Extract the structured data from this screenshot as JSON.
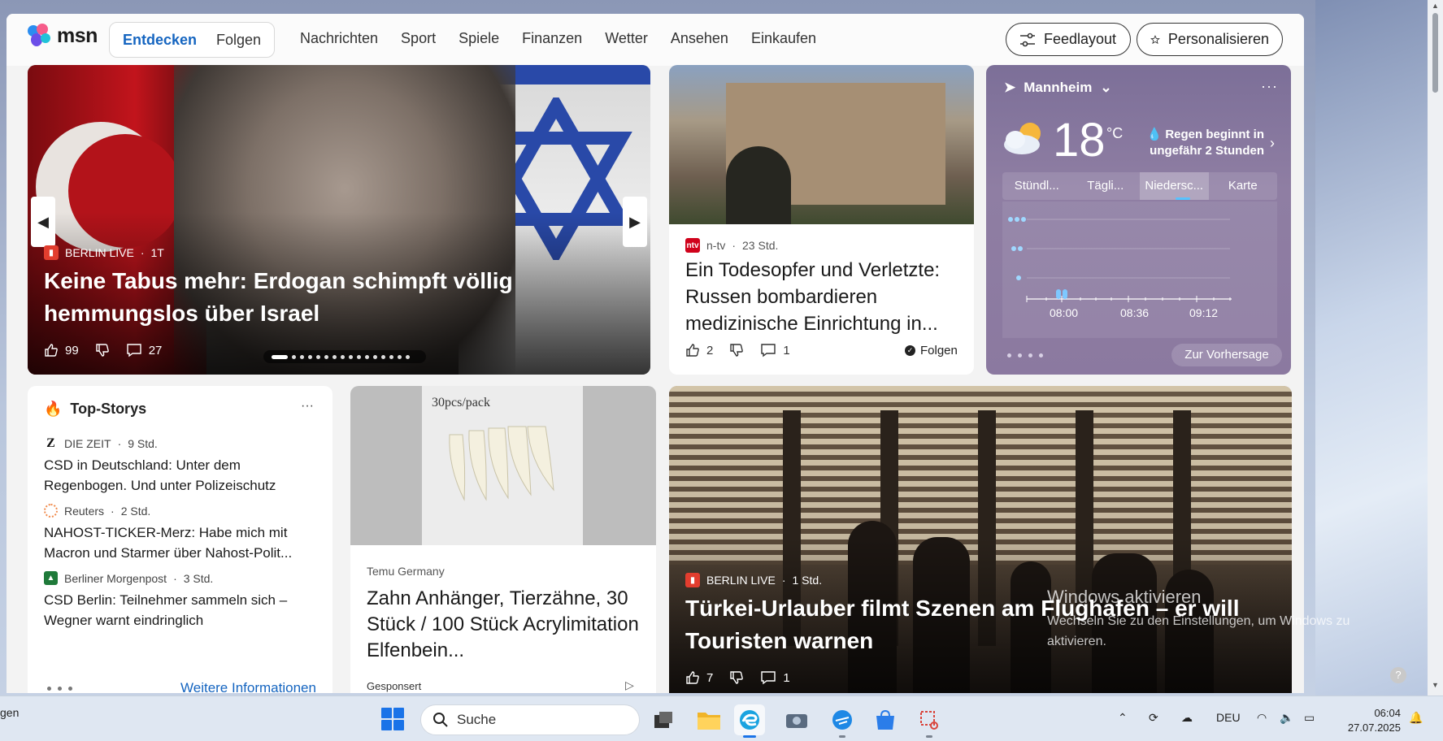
{
  "header": {
    "logo_text": "msn",
    "tabs": [
      {
        "label": "Entdecken",
        "active": true
      },
      {
        "label": "Folgen",
        "active": false
      }
    ],
    "nav": [
      "Nachrichten",
      "Sport",
      "Spiele",
      "Finanzen",
      "Wetter",
      "Ansehen",
      "Einkaufen"
    ],
    "feed_layout_label": "Feedlayout",
    "personalize_label": "Personalisieren"
  },
  "hero": {
    "source": "BERLIN LIVE",
    "time": "1T",
    "title": "Keine Tabus mehr: Erdogan schimpft völlig hemmungslos über Israel",
    "likes": "99",
    "comments": "27"
  },
  "ntv": {
    "source": "n-tv",
    "time": "23 Std.",
    "title": "Ein Todesopfer und Verletzte: Russen bombardieren medizinische Einrichtung in...",
    "likes": "2",
    "comments": "1",
    "follow_label": "Folgen"
  },
  "weather": {
    "location": "Mannheim",
    "temperature": "18",
    "unit": "°C",
    "rain_notice": "Regen beginnt in ungefähr 2 Stunden",
    "tabs": [
      "Stündl...",
      "Tägli...",
      "Niedersc...",
      "Karte"
    ],
    "active_tab": "Niedersc...",
    "time_ticks": [
      "08:00",
      "08:36",
      "09:12"
    ],
    "forecast_label": "Zur Vorhersage",
    "accent": "#58c3ff"
  },
  "top_stories": {
    "title": "Top-Storys",
    "items": [
      {
        "source": "DIE ZEIT",
        "time": "9 Std.",
        "title": "CSD in Deutschland: Unter dem Regenbogen. Und unter Polizeischutz"
      },
      {
        "source": "Reuters",
        "time": "2 Std.",
        "title": "NAHOST-TICKER-Merz: Habe mich mit Macron und Starmer über Nahost-Polit..."
      },
      {
        "source": "Berliner Morgenpost",
        "time": "3 Std.",
        "title": "CSD Berlin: Teilnehmer sammeln sich – Wegner warnt eindringlich"
      }
    ],
    "more_label": "Weitere Informationen"
  },
  "temu": {
    "pack_text": "30pcs/pack",
    "source": "Temu Germany",
    "title": "Zahn Anhänger, Tierzähne, 30 Stück / 100 Stück Acrylimitation Elfenbein...",
    "sponsored_label": "Gesponsert"
  },
  "airport": {
    "source": "BERLIN LIVE",
    "time": "1 Std.",
    "title": "Türkei-Urlauber filmt Szenen am Flughafen – er will Touristen warnen",
    "likes": "7",
    "comments": "1"
  },
  "activation": {
    "title": "Windows aktivieren",
    "text": "Wechseln Sie zu den Einstellungen, um Windows zu aktivieren."
  },
  "taskbar": {
    "left_text": "gen",
    "search_placeholder": "Suche",
    "lang": "DEU",
    "time": "06:04",
    "date": "27.07.2025"
  }
}
